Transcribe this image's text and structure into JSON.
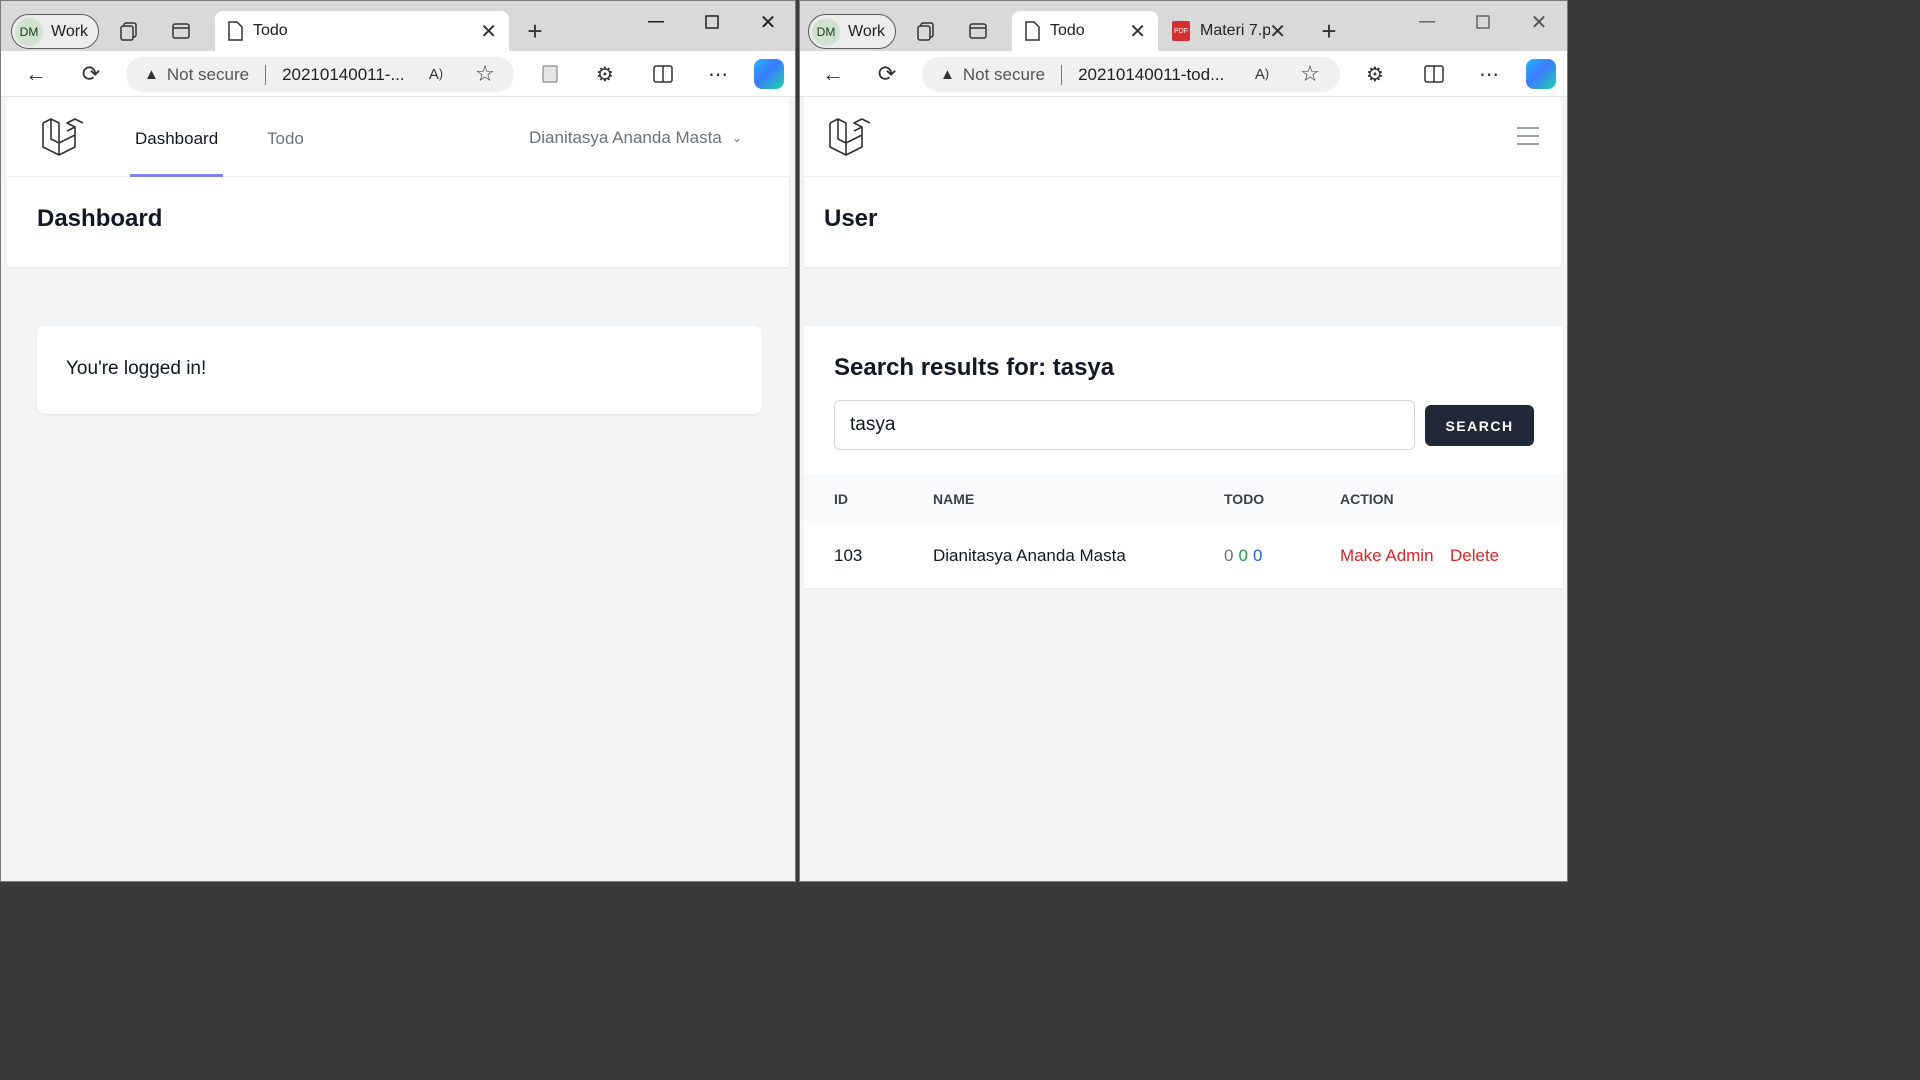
{
  "left": {
    "profile": {
      "initials": "DM",
      "label": "Work"
    },
    "tab": {
      "label": "Todo"
    },
    "address": {
      "warning": "Not secure",
      "url": "20210140011-..."
    },
    "nav": {
      "dashboard": "Dashboard",
      "todo": "Todo",
      "user": "Dianitasya Ananda Masta"
    },
    "header": {
      "title": "Dashboard"
    },
    "card": {
      "message": "You're logged in!"
    }
  },
  "right": {
    "profile": {
      "initials": "DM",
      "label": "Work"
    },
    "tabs": [
      {
        "label": "Todo"
      },
      {
        "label": "Materi 7.p"
      }
    ],
    "address": {
      "warning": "Not secure",
      "url": "20210140011-tod..."
    },
    "header": {
      "title": "User"
    },
    "search": {
      "title": "Search results for: tasya",
      "value": "tasya",
      "button": "SEARCH"
    },
    "table": {
      "headers": [
        "ID",
        "NAME",
        "TODO",
        "ACTION"
      ],
      "rows": [
        {
          "id": "103",
          "name": "Dianitasya Ananda Masta",
          "todo": [
            "0",
            "0",
            "0"
          ],
          "actions": [
            "Make Admin",
            "Delete"
          ]
        }
      ]
    }
  },
  "colors": {
    "accent": "#8183f4",
    "danger": "#dc2626",
    "todo_gray": "#6b7280",
    "todo_green": "#16a34a",
    "todo_blue": "#2563eb",
    "dark_button": "#1f2937"
  }
}
